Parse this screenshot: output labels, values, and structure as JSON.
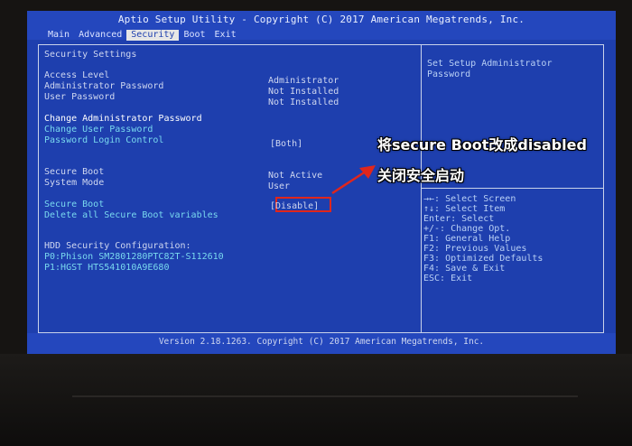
{
  "bios": {
    "title": "Aptio Setup Utility - Copyright (C) 2017 American Megatrends, Inc.",
    "tabs": [
      "Main",
      "Advanced",
      "Security",
      "Boot",
      "Exit"
    ],
    "active_tab": "Security",
    "section_title": "Security Settings",
    "access_level": {
      "label": "Access Level",
      "value": "Administrator"
    },
    "admin_password": {
      "label": "Administrator Password",
      "value": "Not Installed"
    },
    "user_password": {
      "label": "User Password",
      "value": "Not Installed"
    },
    "change_admin_password": "Change Administrator Password",
    "change_user_password": "Change User Password",
    "password_login_control": {
      "label": "Password Login Control",
      "value": "[Both]"
    },
    "secure_boot_status": {
      "label": "Secure Boot",
      "value": "Not Active"
    },
    "system_mode": {
      "label": "System Mode",
      "value": "User"
    },
    "secure_boot_option": {
      "label": "Secure Boot",
      "value": "[Disable]"
    },
    "delete_secure_boot_vars": "Delete all Secure Boot variables",
    "hdd_security": {
      "title": "HDD Security Configuration:",
      "p0": "P0:Phison SM2801280PTC82T-S112610",
      "p1": "P1:HGST HTS541010A9E680"
    },
    "help_text": [
      "Set Setup Administrator",
      "Password"
    ],
    "keys": [
      "→←: Select Screen",
      "↑↓: Select Item",
      "Enter: Select",
      "+/-: Change Opt.",
      "F1: General Help",
      "F2: Previous Values",
      "F3: Optimized Defaults",
      "F4: Save & Exit",
      "ESC: Exit"
    ],
    "version": "Version 2.18.1263. Copyright (C) 2017 American Megatrends, Inc."
  },
  "annotation": {
    "line1": "将secure Boot改成disabled",
    "line2": "关闭安全启动",
    "color": "#e0261c"
  }
}
